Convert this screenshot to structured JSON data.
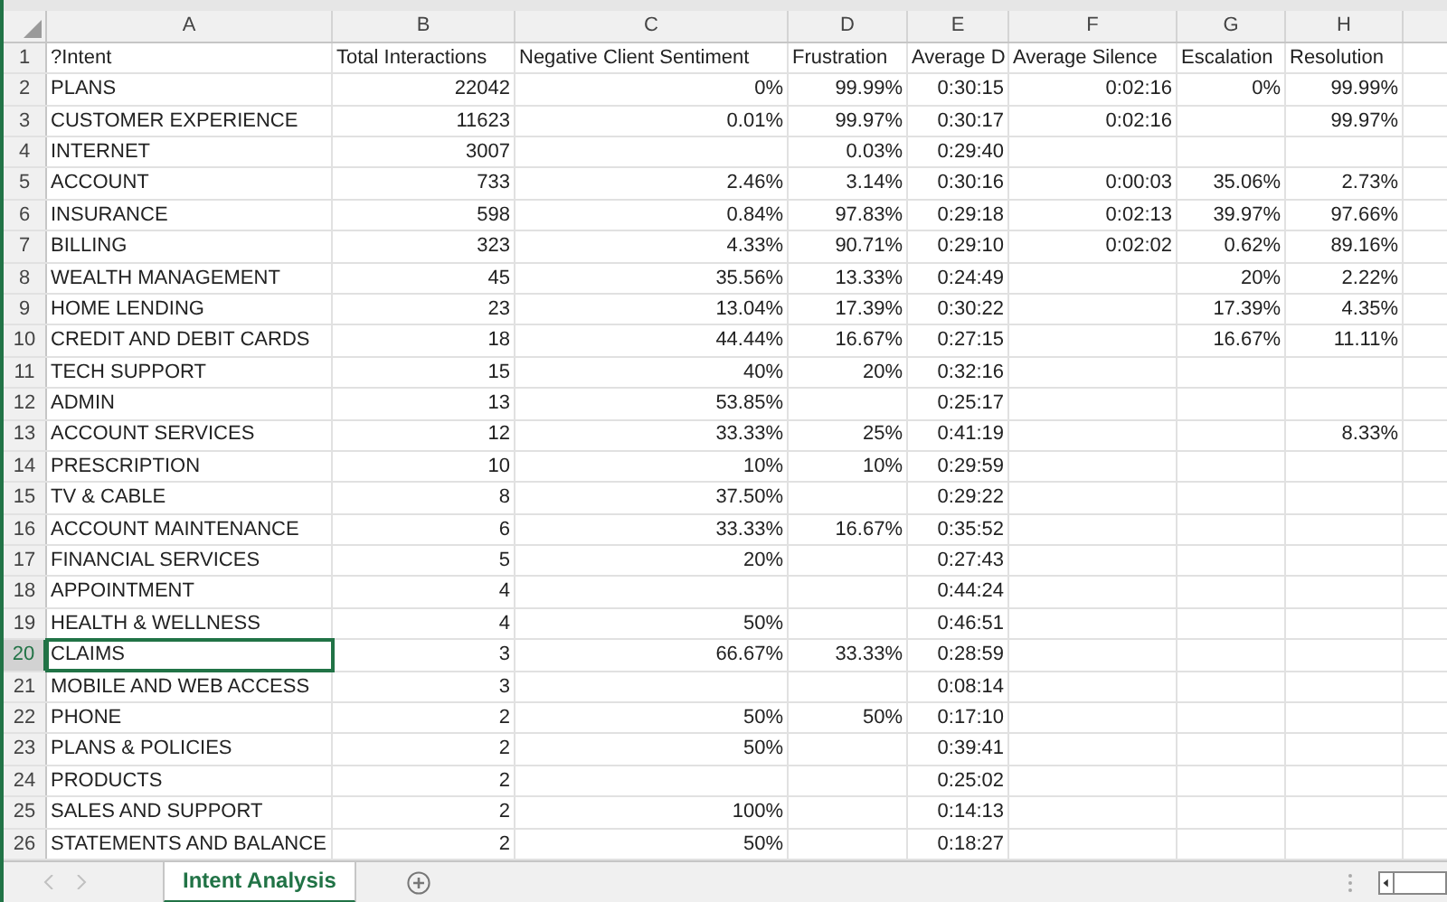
{
  "columns": [
    "A",
    "B",
    "C",
    "D",
    "E",
    "F",
    "G",
    "H"
  ],
  "rows": [
    {
      "number": "1",
      "selected": false,
      "cells": {
        "A": "?Intent",
        "B": "Total Interactions",
        "C": "Negative Client Sentiment",
        "D": "Frustration",
        "E": "Average D",
        "F": "Average Silence",
        "G": "Escalation",
        "H": "Resolution"
      }
    },
    {
      "number": "2",
      "selected": false,
      "cells": {
        "A": "PLANS",
        "B": "22042",
        "C": "0%",
        "D": "99.99%",
        "E": "0:30:15",
        "F": "0:02:16",
        "G": "0%",
        "H": "99.99%"
      }
    },
    {
      "number": "3",
      "selected": false,
      "cells": {
        "A": "CUSTOMER EXPERIENCE",
        "B": "11623",
        "C": "0.01%",
        "D": "99.97%",
        "E": "0:30:17",
        "F": "0:02:16",
        "H": "99.97%"
      }
    },
    {
      "number": "4",
      "selected": false,
      "cells": {
        "A": "INTERNET",
        "B": "3007",
        "D": "0.03%",
        "E": "0:29:40"
      }
    },
    {
      "number": "5",
      "selected": false,
      "cells": {
        "A": "ACCOUNT",
        "B": "733",
        "C": "2.46%",
        "D": "3.14%",
        "E": "0:30:16",
        "F": "0:00:03",
        "G": "35.06%",
        "H": "2.73%"
      }
    },
    {
      "number": "6",
      "selected": false,
      "cells": {
        "A": "INSURANCE",
        "B": "598",
        "C": "0.84%",
        "D": "97.83%",
        "E": "0:29:18",
        "F": "0:02:13",
        "G": "39.97%",
        "H": "97.66%"
      }
    },
    {
      "number": "7",
      "selected": false,
      "cells": {
        "A": "BILLING",
        "B": "323",
        "C": "4.33%",
        "D": "90.71%",
        "E": "0:29:10",
        "F": "0:02:02",
        "G": "0.62%",
        "H": "89.16%"
      }
    },
    {
      "number": "8",
      "selected": false,
      "cells": {
        "A": "WEALTH MANAGEMENT",
        "B": "45",
        "C": "35.56%",
        "D": "13.33%",
        "E": "0:24:49",
        "G": "20%",
        "H": "2.22%"
      }
    },
    {
      "number": "9",
      "selected": false,
      "cells": {
        "A": "HOME LENDING",
        "B": "23",
        "C": "13.04%",
        "D": "17.39%",
        "E": "0:30:22",
        "G": "17.39%",
        "H": "4.35%"
      }
    },
    {
      "number": "10",
      "selected": false,
      "cells": {
        "A": "CREDIT AND DEBIT CARDS",
        "B": "18",
        "C": "44.44%",
        "D": "16.67%",
        "E": "0:27:15",
        "G": "16.67%",
        "H": "11.11%"
      }
    },
    {
      "number": "11",
      "selected": false,
      "cells": {
        "A": "TECH SUPPORT",
        "B": "15",
        "C": "40%",
        "D": "20%",
        "E": "0:32:16"
      }
    },
    {
      "number": "12",
      "selected": false,
      "cells": {
        "A": "ADMIN",
        "B": "13",
        "C": "53.85%",
        "E": "0:25:17"
      }
    },
    {
      "number": "13",
      "selected": false,
      "cells": {
        "A": "ACCOUNT SERVICES",
        "B": "12",
        "C": "33.33%",
        "D": "25%",
        "E": "0:41:19",
        "H": "8.33%"
      }
    },
    {
      "number": "14",
      "selected": false,
      "cells": {
        "A": "PRESCRIPTION",
        "B": "10",
        "C": "10%",
        "D": "10%",
        "E": "0:29:59"
      }
    },
    {
      "number": "15",
      "selected": false,
      "cells": {
        "A": "TV & CABLE",
        "B": "8",
        "C": "37.50%",
        "E": "0:29:22"
      }
    },
    {
      "number": "16",
      "selected": false,
      "cells": {
        "A": "ACCOUNT MAINTENANCE",
        "B": "6",
        "C": "33.33%",
        "D": "16.67%",
        "E": "0:35:52"
      }
    },
    {
      "number": "17",
      "selected": false,
      "cells": {
        "A": "FINANCIAL SERVICES",
        "B": "5",
        "C": "20%",
        "E": "0:27:43"
      }
    },
    {
      "number": "18",
      "selected": false,
      "cells": {
        "A": "APPOINTMENT",
        "B": "4",
        "E": "0:44:24"
      }
    },
    {
      "number": "19",
      "selected": false,
      "cells": {
        "A": "HEALTH & WELLNESS",
        "B": "4",
        "C": "50%",
        "E": "0:46:51"
      }
    },
    {
      "number": "20",
      "selected": true,
      "cells": {
        "A": "CLAIMS",
        "B": "3",
        "C": "66.67%",
        "D": "33.33%",
        "E": "0:28:59"
      }
    },
    {
      "number": "21",
      "selected": false,
      "cells": {
        "A": "MOBILE AND WEB ACCESS",
        "B": "3",
        "E": "0:08:14"
      }
    },
    {
      "number": "22",
      "selected": false,
      "cells": {
        "A": "PHONE",
        "B": "2",
        "C": "50%",
        "D": "50%",
        "E": "0:17:10"
      }
    },
    {
      "number": "23",
      "selected": false,
      "cells": {
        "A": "PLANS & POLICIES",
        "B": "2",
        "C": "50%",
        "E": "0:39:41"
      }
    },
    {
      "number": "24",
      "selected": false,
      "cells": {
        "A": "PRODUCTS",
        "B": "2",
        "E": "0:25:02"
      }
    },
    {
      "number": "25",
      "selected": false,
      "cells": {
        "A": "SALES AND SUPPORT",
        "B": "2",
        "C": "100%",
        "E": "0:14:13"
      }
    },
    {
      "number": "26",
      "selected": false,
      "cells": {
        "A": "STATEMENTS AND BALANCE",
        "B": "2",
        "C": "50%",
        "E": "0:18:27"
      }
    }
  ],
  "sheet_tabs": [
    {
      "label": "Intent Analysis",
      "selected": true
    }
  ]
}
